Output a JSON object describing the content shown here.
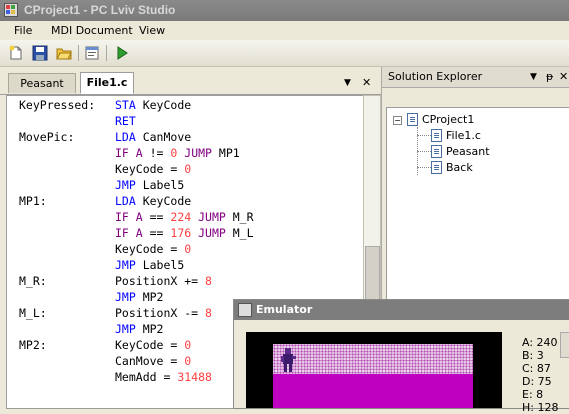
{
  "window": {
    "title": "CProject1 - PC Lviv Studio"
  },
  "menu": [
    "File",
    "MDI Document",
    "View"
  ],
  "toolbar": {
    "icons": [
      "new-file-icon",
      "save-icon",
      "open-folder-icon",
      "properties-icon",
      "run-icon"
    ]
  },
  "editor": {
    "tabs": [
      {
        "label": "Peasant",
        "active": false
      },
      {
        "label": "File1.c",
        "active": true
      }
    ],
    "tab_controls": {
      "dropdown": "▼",
      "close": "✕"
    },
    "code": [
      {
        "label": "KeyPressed:",
        "tokens": [
          {
            "t": "STA ",
            "c": "kw"
          },
          {
            "t": "KeyCode",
            "c": ""
          }
        ]
      },
      {
        "label": "",
        "tokens": [
          {
            "t": "RET",
            "c": "kw"
          }
        ]
      },
      {
        "label": "MovePic:",
        "tokens": [
          {
            "t": "LDA ",
            "c": "kw"
          },
          {
            "t": "CanMove",
            "c": ""
          }
        ]
      },
      {
        "label": "",
        "tokens": [
          {
            "t": "IF A ",
            "c": "pu"
          },
          {
            "t": "!= ",
            "c": ""
          },
          {
            "t": "0 ",
            "c": "nm"
          },
          {
            "t": "JUMP ",
            "c": "pu"
          },
          {
            "t": "MP1",
            "c": ""
          }
        ]
      },
      {
        "label": "",
        "tokens": [
          {
            "t": "KeyCode = ",
            "c": ""
          },
          {
            "t": "0",
            "c": "nm"
          }
        ]
      },
      {
        "label": "",
        "tokens": [
          {
            "t": "JMP ",
            "c": "kw"
          },
          {
            "t": "Label5",
            "c": ""
          }
        ]
      },
      {
        "label": "MP1:",
        "tokens": [
          {
            "t": "LDA ",
            "c": "kw"
          },
          {
            "t": "KeyCode",
            "c": ""
          }
        ]
      },
      {
        "label": "",
        "tokens": [
          {
            "t": "IF A ",
            "c": "pu"
          },
          {
            "t": "== ",
            "c": ""
          },
          {
            "t": "224 ",
            "c": "nm"
          },
          {
            "t": "JUMP ",
            "c": "pu"
          },
          {
            "t": "M_R",
            "c": ""
          }
        ]
      },
      {
        "label": "",
        "tokens": [
          {
            "t": "IF A ",
            "c": "pu"
          },
          {
            "t": "== ",
            "c": ""
          },
          {
            "t": "176 ",
            "c": "nm"
          },
          {
            "t": "JUMP ",
            "c": "pu"
          },
          {
            "t": "M_L",
            "c": ""
          }
        ]
      },
      {
        "label": "",
        "tokens": [
          {
            "t": "KeyCode = ",
            "c": ""
          },
          {
            "t": "0",
            "c": "nm"
          }
        ]
      },
      {
        "label": "",
        "tokens": [
          {
            "t": "JMP ",
            "c": "kw"
          },
          {
            "t": "Label5",
            "c": ""
          }
        ]
      },
      {
        "label": "M_R:",
        "tokens": [
          {
            "t": "PositionX += ",
            "c": ""
          },
          {
            "t": "8",
            "c": "nm"
          }
        ]
      },
      {
        "label": "",
        "tokens": [
          {
            "t": "JMP ",
            "c": "kw"
          },
          {
            "t": "MP2",
            "c": ""
          }
        ]
      },
      {
        "label": "M_L:",
        "tokens": [
          {
            "t": "PositionX -= ",
            "c": ""
          },
          {
            "t": "8",
            "c": "nm"
          }
        ]
      },
      {
        "label": "",
        "tokens": [
          {
            "t": "JMP ",
            "c": "kw"
          },
          {
            "t": "MP2",
            "c": ""
          }
        ]
      },
      {
        "label": "MP2:",
        "tokens": [
          {
            "t": "KeyCode = ",
            "c": ""
          },
          {
            "t": "0",
            "c": "nm"
          }
        ]
      },
      {
        "label": "",
        "tokens": [
          {
            "t": "CanMove = ",
            "c": ""
          },
          {
            "t": "0",
            "c": "nm"
          }
        ]
      },
      {
        "label": "",
        "tokens": [
          {
            "t": "MemAdd = ",
            "c": ""
          },
          {
            "t": "31488",
            "c": "nm"
          }
        ]
      }
    ]
  },
  "solution_explorer": {
    "title": "Solution Explorer",
    "controls": {
      "dropdown": "▼",
      "pin": "ᵽ",
      "close": "✕"
    },
    "root": "CProject1",
    "expander": "−",
    "children": [
      "File1.c",
      "Peasant",
      "Back"
    ]
  },
  "emulator": {
    "title": "Emulator",
    "registers": [
      "A: 240",
      "B: 3",
      "C: 87",
      "D: 75",
      "E: 8",
      "H: 128"
    ]
  }
}
